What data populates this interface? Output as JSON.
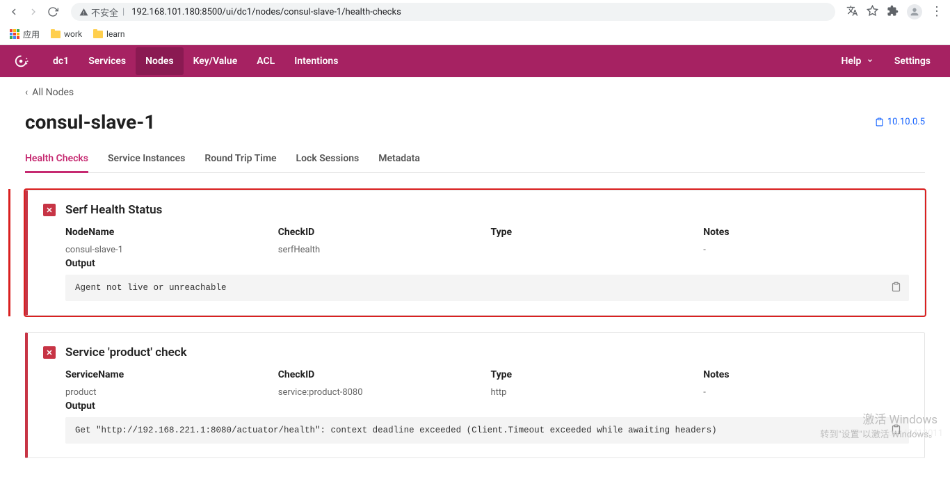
{
  "browser": {
    "insecure_label": "不安全",
    "url_display": "192.168.101.180:8500/ui/dc1/nodes/consul-slave-1/health-checks",
    "bookmarks": {
      "apps": "应用",
      "work": "work",
      "learn": "learn"
    }
  },
  "nav": {
    "dc": "dc1",
    "items": [
      "Services",
      "Nodes",
      "Key/Value",
      "ACL",
      "Intentions"
    ],
    "active": "Nodes",
    "help": "Help",
    "settings": "Settings"
  },
  "breadcrumb": {
    "back_label": "All Nodes"
  },
  "page": {
    "title": "consul-slave-1",
    "ip": "10.10.0.5"
  },
  "tabs": {
    "items": [
      "Health Checks",
      "Service Instances",
      "Round Trip Time",
      "Lock Sessions",
      "Metadata"
    ],
    "active": "Health Checks"
  },
  "labels": {
    "node_name": "NodeName",
    "service_name": "ServiceName",
    "check_id": "CheckID",
    "type": "Type",
    "notes": "Notes",
    "output": "Output"
  },
  "checks": [
    {
      "title": "Serf Health Status",
      "name_label_key": "node_name",
      "name_value": "consul-slave-1",
      "check_id": "serfHealth",
      "type": "",
      "notes": "-",
      "output": "Agent not live or unreachable",
      "highlighted": true
    },
    {
      "title": "Service 'product' check",
      "name_label_key": "service_name",
      "name_value": "product",
      "check_id": "service:product-8080",
      "type": "http",
      "notes": "-",
      "output": "Get \"http://192.168.221.1:8080/actuator/health\": context deadline exceeded (Client.Timeout exceeded while awaiting headers)",
      "highlighted": false
    }
  ],
  "watermark": {
    "line1": "激活 Windows",
    "line2": "转到\"设置\"以激活 Windows。",
    "faint": "n.net/qq_42413011"
  }
}
